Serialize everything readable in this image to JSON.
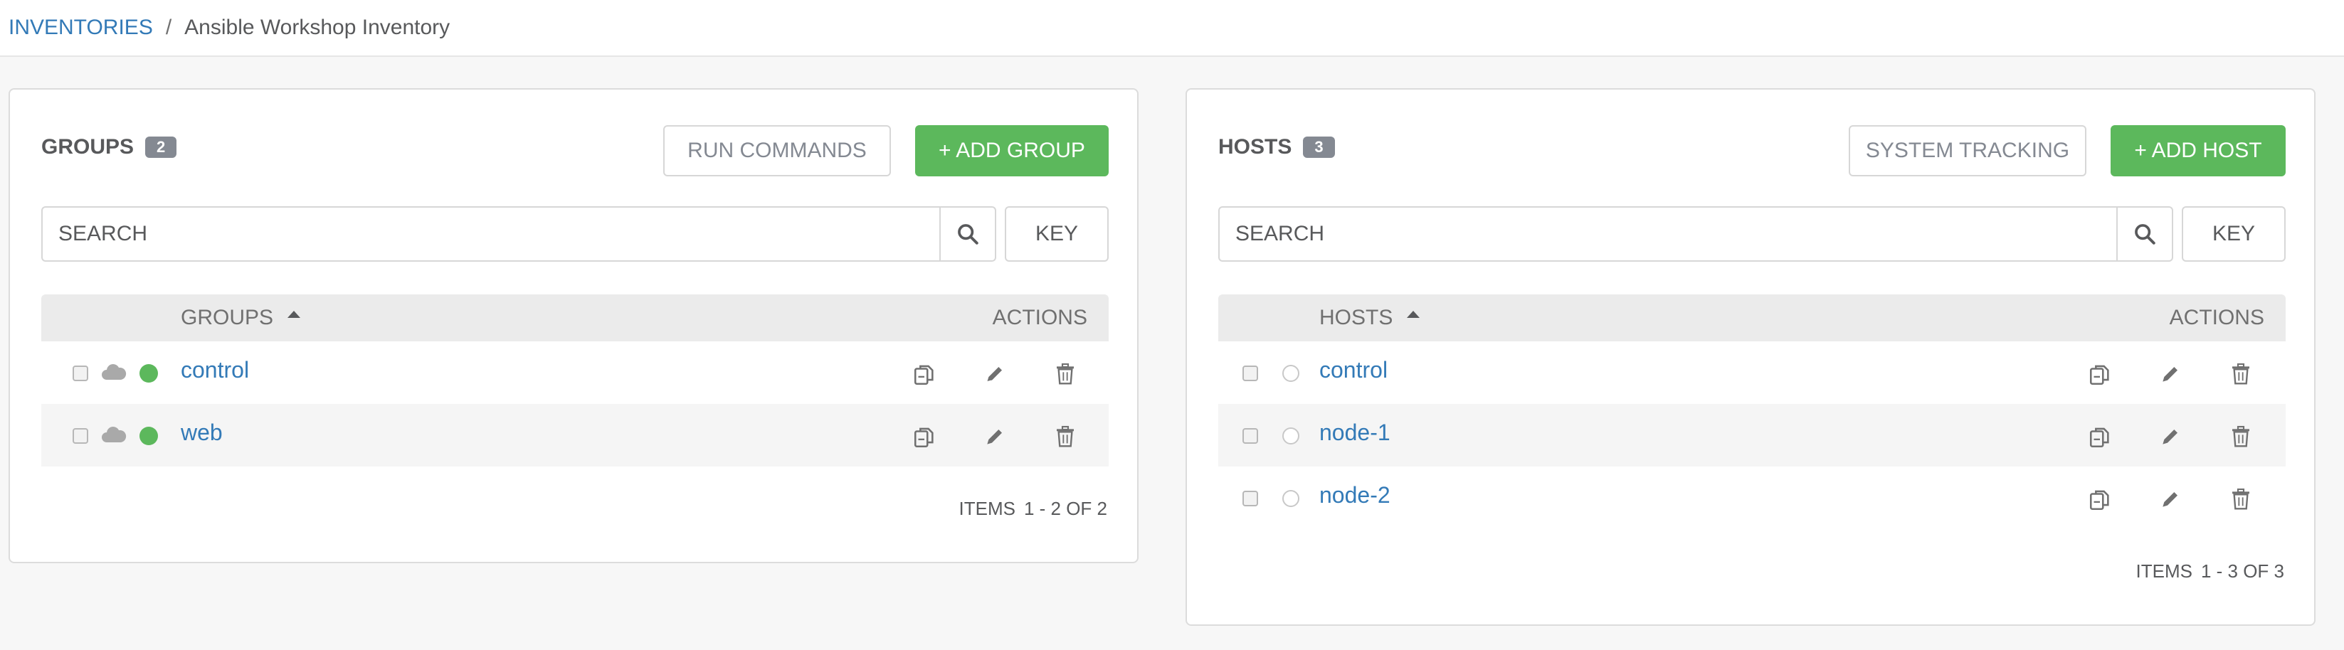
{
  "breadcrumb": {
    "root": "INVENTORIES",
    "separator": "/",
    "current": "Ansible Workshop Inventory"
  },
  "groups_panel": {
    "title": "GROUPS",
    "count": "2",
    "run_commands_label": "RUN COMMANDS",
    "add_label": "+ ADD GROUP",
    "search_placeholder": "SEARCH",
    "key_label": "KEY",
    "column_name": "GROUPS",
    "column_actions": "ACTIONS",
    "rows": [
      {
        "name": "control",
        "status": "ok"
      },
      {
        "name": "web",
        "status": "ok"
      }
    ],
    "items_label": "ITEMS",
    "items_range": "1 - 2 OF 2"
  },
  "hosts_panel": {
    "title": "HOSTS",
    "count": "3",
    "system_tracking_label": "SYSTEM TRACKING",
    "add_label": "+ ADD HOST",
    "search_placeholder": "SEARCH",
    "key_label": "KEY",
    "column_name": "HOSTS",
    "column_actions": "ACTIONS",
    "rows": [
      {
        "name": "control",
        "status": "none"
      },
      {
        "name": "node-1",
        "status": "none"
      },
      {
        "name": "node-2",
        "status": "none"
      }
    ],
    "items_label": "ITEMS",
    "items_range": "1 - 3 OF 3"
  },
  "colors": {
    "link": "#337ab7",
    "success": "#5cb85c",
    "badge": "#848992",
    "header_bg": "#ebebeb"
  },
  "icons": {
    "search": "search-icon",
    "cloud": "cloud-icon",
    "copy": "copy-icon",
    "edit": "pencil-icon",
    "delete": "trash-icon"
  }
}
